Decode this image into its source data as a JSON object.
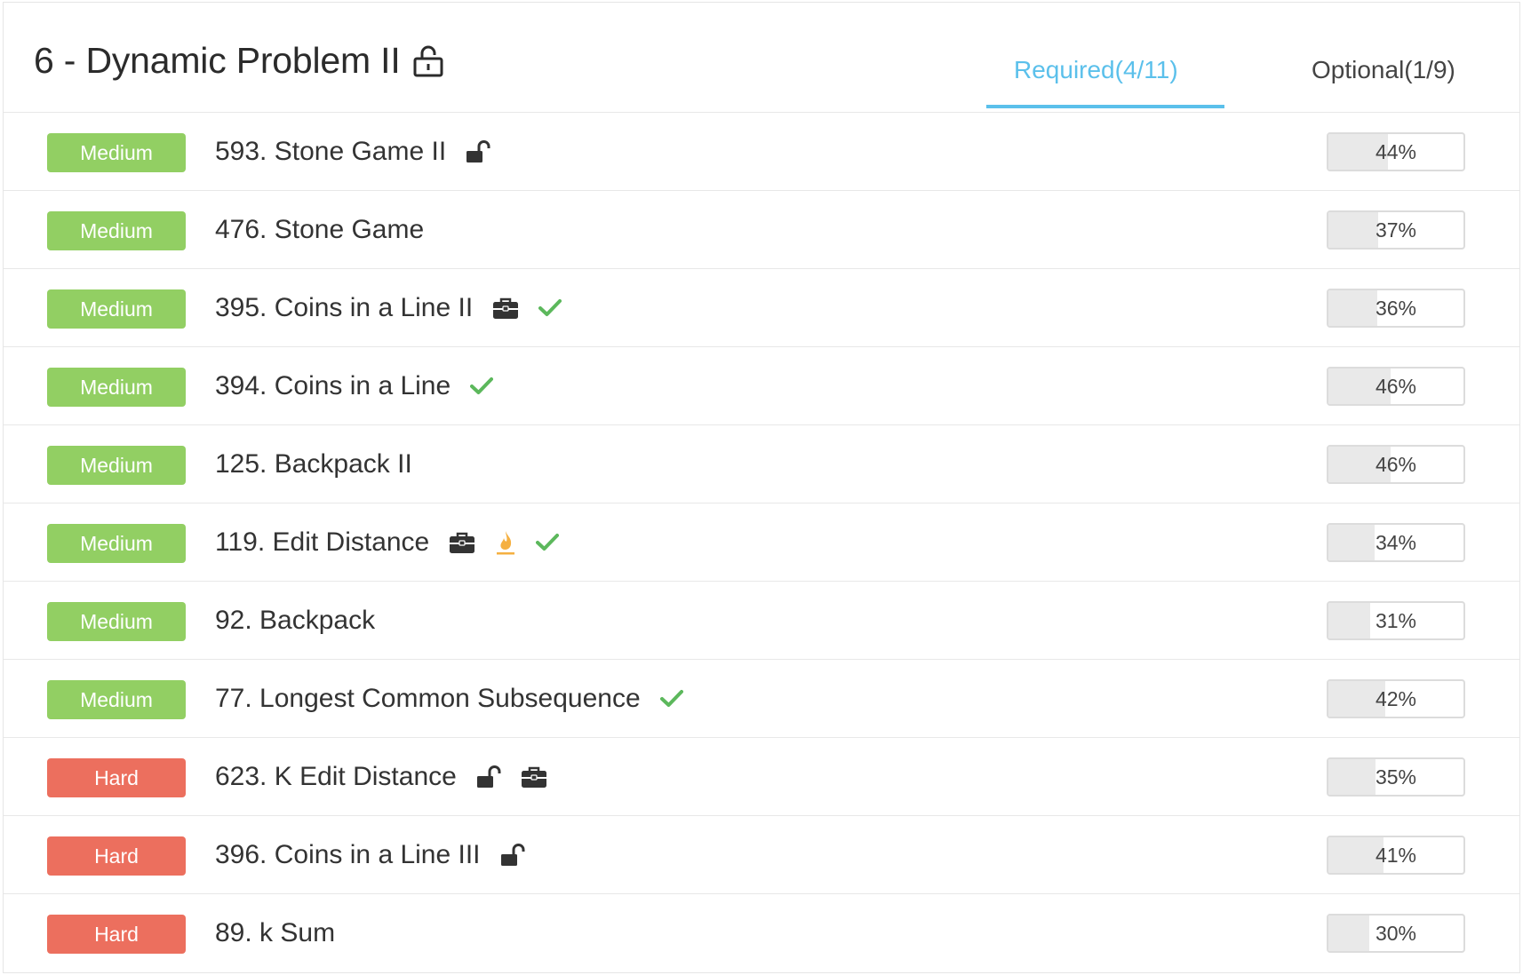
{
  "header": {
    "title": "6 - Dynamic Problem II",
    "tabs": {
      "required": "Required(4/11)",
      "optional": "Optional(1/9)"
    }
  },
  "problems": [
    {
      "difficulty": "Medium",
      "level": "medium",
      "title": "593. Stone Game II",
      "icons": [
        "unlock-icon"
      ],
      "rate_label": "44%",
      "rate": 44
    },
    {
      "difficulty": "Medium",
      "level": "medium",
      "title": "476. Stone Game",
      "icons": [],
      "rate_label": "37%",
      "rate": 37
    },
    {
      "difficulty": "Medium",
      "level": "medium",
      "title": "395. Coins in a Line II",
      "icons": [
        "briefcase-icon",
        "check-icon"
      ],
      "rate_label": "36%",
      "rate": 36
    },
    {
      "difficulty": "Medium",
      "level": "medium",
      "title": "394. Coins in a Line",
      "icons": [
        "check-icon"
      ],
      "rate_label": "46%",
      "rate": 46
    },
    {
      "difficulty": "Medium",
      "level": "medium",
      "title": "125. Backpack II",
      "icons": [],
      "rate_label": "46%",
      "rate": 46
    },
    {
      "difficulty": "Medium",
      "level": "medium",
      "title": "119. Edit Distance",
      "icons": [
        "briefcase-icon",
        "flame-icon",
        "check-icon"
      ],
      "rate_label": "34%",
      "rate": 34
    },
    {
      "difficulty": "Medium",
      "level": "medium",
      "title": "92. Backpack",
      "icons": [],
      "rate_label": "31%",
      "rate": 31
    },
    {
      "difficulty": "Medium",
      "level": "medium",
      "title": "77. Longest Common Subsequence",
      "icons": [
        "check-icon"
      ],
      "rate_label": "42%",
      "rate": 42
    },
    {
      "difficulty": "Hard",
      "level": "hard",
      "title": "623. K Edit Distance",
      "icons": [
        "unlock-icon",
        "briefcase-icon"
      ],
      "rate_label": "35%",
      "rate": 35
    },
    {
      "difficulty": "Hard",
      "level": "hard",
      "title": "396. Coins in a Line III",
      "icons": [
        "unlock-icon"
      ],
      "rate_label": "41%",
      "rate": 41
    },
    {
      "difficulty": "Hard",
      "level": "hard",
      "title": "89. k Sum",
      "icons": [],
      "rate_label": "30%",
      "rate": 30
    }
  ],
  "colors": {
    "medium": "#92cf63",
    "hard": "#ec6f5e",
    "accent": "#5bc0eb",
    "check": "#5cb85c",
    "flame": "#f5b041"
  }
}
